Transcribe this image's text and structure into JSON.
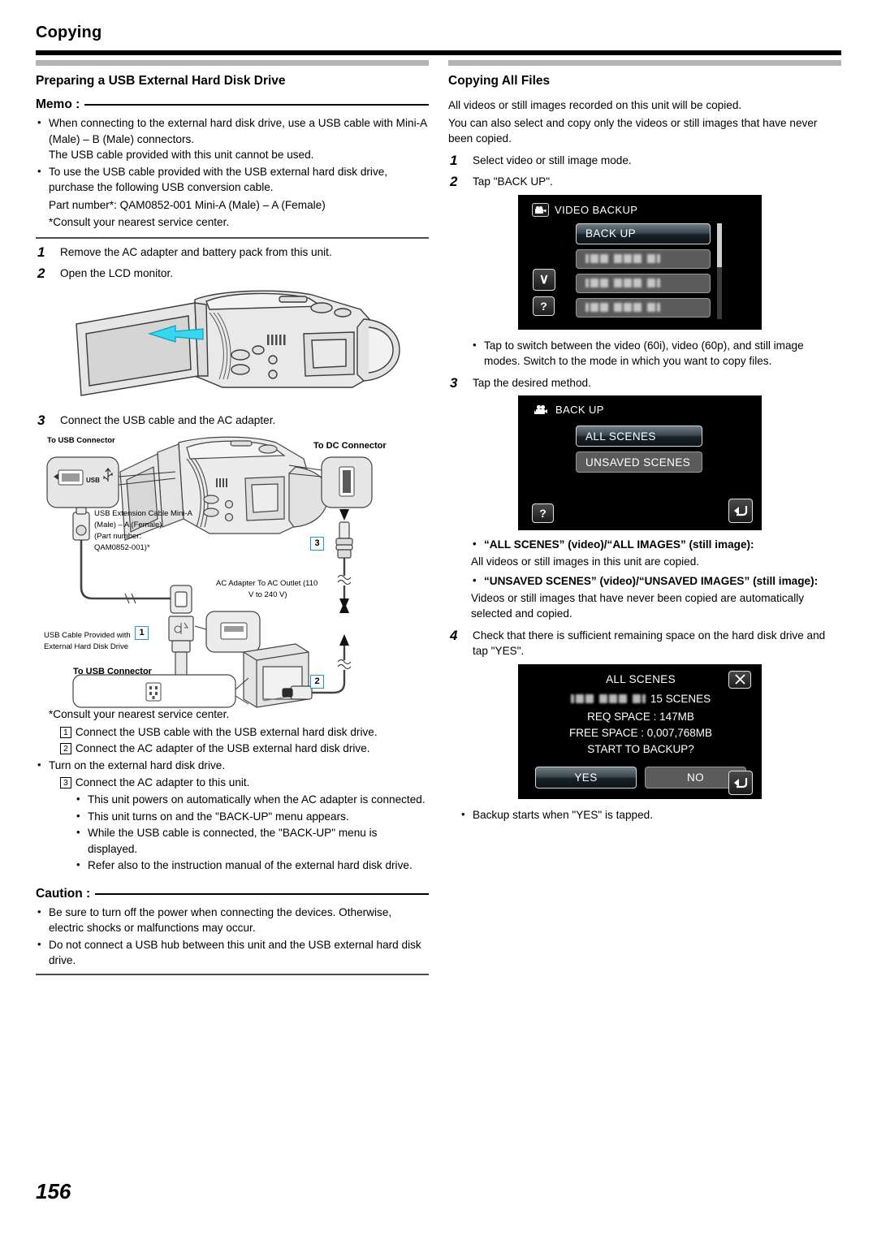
{
  "chapter": {
    "title": "Copying"
  },
  "page_number": "156",
  "left": {
    "section_title": "Preparing a USB External Hard Disk Drive",
    "memo_label": "Memo :",
    "memo_items": [
      "When connecting to the external hard disk drive, use a USB cable with Mini-A (Male) – B (Male) connectors.",
      "The USB cable provided with this unit cannot be used.",
      "To use the USB cable provided with the USB external hard disk drive, purchase the following USB conversion cable."
    ],
    "memo_part_number": "Part number*: QAM0852-001 Mini-A (Male) – A (Female)",
    "memo_consult": "*Consult your nearest service center.",
    "steps": [
      {
        "num": "1",
        "text": "Remove the AC adapter and battery pack from this unit."
      },
      {
        "num": "2",
        "text": "Open the LCD monitor."
      },
      {
        "num": "3",
        "text": "Connect the USB cable and the AC adapter."
      }
    ],
    "diagram": {
      "to_usb_connector_top": "To USB Connector",
      "to_dc_connector": "To DC Connector",
      "usb_ext_cable": "USB Extension Cable Mini-A (Male) – A (Female) (Part number: QAM0852-001)*",
      "usb_ext_cable_l1": "USB Extension Cable Mini-A",
      "usb_ext_cable_l2": "(Male) – A (Female)",
      "usb_ext_cable_l3": "(Part number:",
      "usb_ext_cable_l4": "QAM0852-001)*",
      "ac_adapter_outlet_l1": "AC Adapter To AC Outlet (110",
      "ac_adapter_outlet_l2": "V to 240 V)",
      "usb_cable_provided_l1": "USB Cable Provided with",
      "usb_cable_provided_l2": "External Hard Disk Drive",
      "to_usb_connector_bottom": "To USB Connector",
      "callout_1": "1",
      "callout_2": "2",
      "callout_3": "3",
      "usb_port_label": "USB"
    },
    "after_diagram_consult": "*Consult your nearest service center.",
    "numbered_boxes": [
      {
        "num": "1",
        "text": "Connect the USB cable with the USB external hard disk drive."
      },
      {
        "num": "2",
        "text": "Connect the AC adapter of the USB external hard disk drive."
      }
    ],
    "turn_on_bullet": "Turn on the external hard disk drive.",
    "numbered_box_3": {
      "num": "3",
      "text": "Connect the AC adapter to this unit."
    },
    "sub_bullets": [
      "This unit powers on automatically when the AC adapter is connected.",
      "This unit turns on and the \"BACK-UP\" menu appears.",
      "While the USB cable is connected, the \"BACK-UP\" menu is displayed.",
      "Refer also to the instruction manual of the external hard disk drive."
    ],
    "caution_label": "Caution :",
    "caution_items": [
      "Be sure to turn off the power when connecting the devices. Otherwise, electric shocks or malfunctions may occur.",
      "Do not connect a USB hub between this unit and the USB external hard disk drive."
    ]
  },
  "right": {
    "section_title": "Copying All Files",
    "intro_l1": "All videos or still images recorded on this unit will be copied.",
    "intro_l2": "You can also select and copy only the videos or still images that have never been copied.",
    "step1": {
      "num": "1",
      "text": "Select video or still image mode."
    },
    "step2": {
      "num": "2",
      "text": "Tap \"BACK UP\"."
    },
    "screen1": {
      "header": "VIDEO BACKUP",
      "header_icon": "video-camera-icon",
      "selected_item": "BACK UP",
      "redacted_items": 3,
      "down_arrow": "∨",
      "help_label": "?"
    },
    "note_after_screen1_l1": "Tap  to switch between the video (60i), video (60p), and still image",
    "note_after_screen1_l2": "modes. Switch to the mode in which you want to copy files.",
    "step3": {
      "num": "3",
      "text": "Tap the desired method."
    },
    "screen2": {
      "header": "BACK UP",
      "header_icon": "video-camera-icon",
      "buttons": [
        "ALL SCENES",
        "UNSAVED SCENES"
      ],
      "help_label": "?",
      "back_icon": "back-arrow-icon"
    },
    "method_notes": [
      {
        "title": "“ALL SCENES” (video)/“ALL IMAGES” (still image):",
        "body": "All videos or still images in this unit are copied."
      },
      {
        "title": "“UNSAVED SCENES” (video)/“UNSAVED IMAGES” (still image):",
        "body": "Videos or still images that have never been copied are automatically selected and copied."
      }
    ],
    "step4": {
      "num": "4",
      "text": "Check that there is sufficient remaining space on the hard disk drive and tap \"YES\"."
    },
    "screen3": {
      "title": "ALL SCENES",
      "scenes_count": "15 SCENES",
      "req_space": "REQ SPACE : 147MB",
      "free_space": "FREE SPACE : 0,007,768MB",
      "prompt": "START TO BACKUP?",
      "yes_label": "YES",
      "no_label": "NO",
      "close_icon": "close-icon",
      "back_icon": "back-arrow-icon"
    },
    "final_note": "Backup starts when \"YES\" is tapped."
  }
}
